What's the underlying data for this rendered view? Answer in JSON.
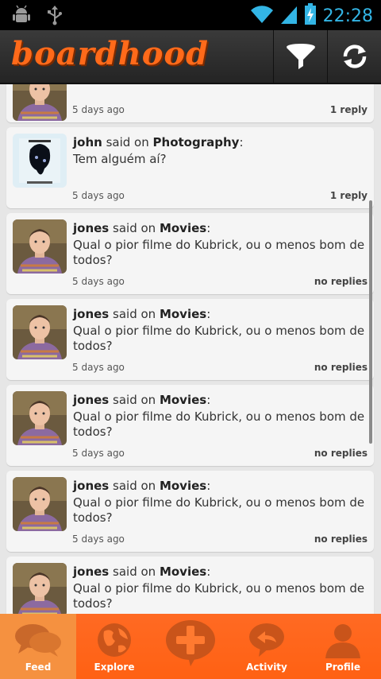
{
  "status_bar": {
    "time": "22:28"
  },
  "app": {
    "logo_text": "boardhood"
  },
  "feed": {
    "said_on": "said on",
    "items": [
      {
        "user": "",
        "board": "",
        "message": "",
        "date": "5 days ago",
        "replies": "1 reply",
        "avatar": "sheldon-avatar"
      },
      {
        "user": "john",
        "board": "Photography",
        "message": "Tem alguém aí?",
        "date": "5 days ago",
        "replies": "1 reply",
        "avatar": "dark-art-avatar"
      },
      {
        "user": "jones",
        "board": "Movies",
        "message": "Qual o pior filme do Kubrick, ou o menos bom de todos?",
        "date": "5 days ago",
        "replies": "no replies",
        "avatar": "sheldon-avatar"
      },
      {
        "user": "jones",
        "board": "Movies",
        "message": "Qual o pior filme do Kubrick, ou o menos bom de todos?",
        "date": "5 days ago",
        "replies": "no replies",
        "avatar": "sheldon-avatar"
      },
      {
        "user": "jones",
        "board": "Movies",
        "message": "Qual o pior filme do Kubrick, ou o menos bom de todos?",
        "date": "5 days ago",
        "replies": "no replies",
        "avatar": "sheldon-avatar"
      },
      {
        "user": "jones",
        "board": "Movies",
        "message": "Qual o pior filme do Kubrick, ou o menos bom de todos?",
        "date": "5 days ago",
        "replies": "no replies",
        "avatar": "sheldon-avatar"
      },
      {
        "user": "jones",
        "board": "Movies",
        "message": "Qual o pior filme do Kubrick, ou o menos bom de todos?",
        "date": "",
        "replies": "",
        "avatar": "sheldon-avatar"
      }
    ]
  },
  "bottom_nav": [
    {
      "label": "Feed",
      "icon": "speech-bubbles-icon",
      "active": true
    },
    {
      "label": "Explore",
      "icon": "globe-icon",
      "active": false
    },
    {
      "label": "",
      "icon": "plus-bubble-icon",
      "active": false
    },
    {
      "label": "Activity",
      "icon": "reply-bubble-icon",
      "active": false
    },
    {
      "label": "Profile",
      "icon": "person-icon",
      "active": false
    }
  ],
  "colors": {
    "brand_orange": "#ff6a1a",
    "status_blue": "#33b5e5"
  }
}
